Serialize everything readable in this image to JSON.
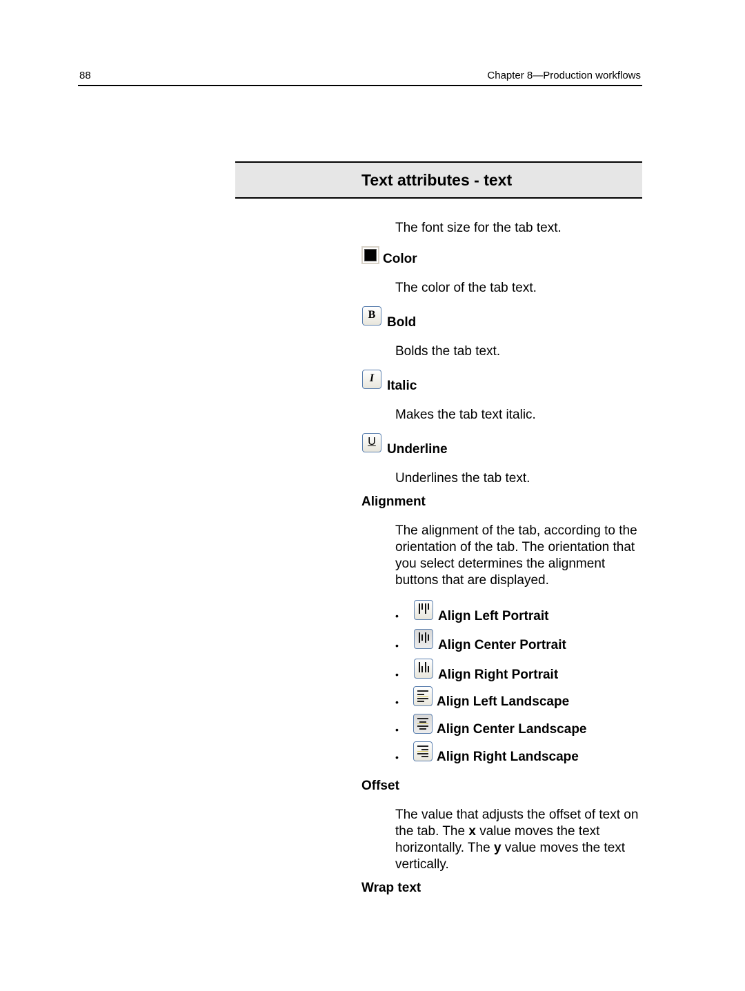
{
  "header": {
    "page_number": "88",
    "chapter": "Chapter 8—Production workflows"
  },
  "section_title": "Text attributes - text",
  "intro": "The font size for the tab text.",
  "attributes": [
    {
      "icon": "color-swatch-icon",
      "label": "Color",
      "description": "The color of the tab text.",
      "swatch_color": "#000000"
    },
    {
      "icon": "bold-icon",
      "glyph": "B",
      "label": "Bold",
      "description": "Bolds the tab text."
    },
    {
      "icon": "italic-icon",
      "glyph": "I",
      "label": "Italic",
      "description": "Makes the tab text italic."
    },
    {
      "icon": "underline-icon",
      "glyph": "U",
      "label": "Underline",
      "description": "Underlines the tab text."
    }
  ],
  "alignment": {
    "heading": "Alignment",
    "description": "The alignment of the tab, according to the orientation of the tab. The orientation that you select determines the alignment buttons that are displayed.",
    "bullet": "•",
    "options": [
      {
        "icon": "align-left-portrait-icon",
        "label": "Align Left Portrait"
      },
      {
        "icon": "align-center-portrait-icon",
        "label": "Align Center Portrait"
      },
      {
        "icon": "align-right-portrait-icon",
        "label": "Align Right Portrait"
      },
      {
        "icon": "align-left-landscape-icon",
        "label": "Align Left Landscape"
      },
      {
        "icon": "align-center-landscape-icon",
        "label": "Align Center Landscape"
      },
      {
        "icon": "align-right-landscape-icon",
        "label": "Align Right Landscape"
      }
    ]
  },
  "offset": {
    "heading": "Offset",
    "text_1": "The value that adjusts the offset of text on the tab. The ",
    "bold_x": "x",
    "text_2": " value moves the text horizontally. The ",
    "bold_y": "y",
    "text_3": " value moves the text vertically."
  },
  "wrap_text": {
    "heading": "Wrap text"
  }
}
